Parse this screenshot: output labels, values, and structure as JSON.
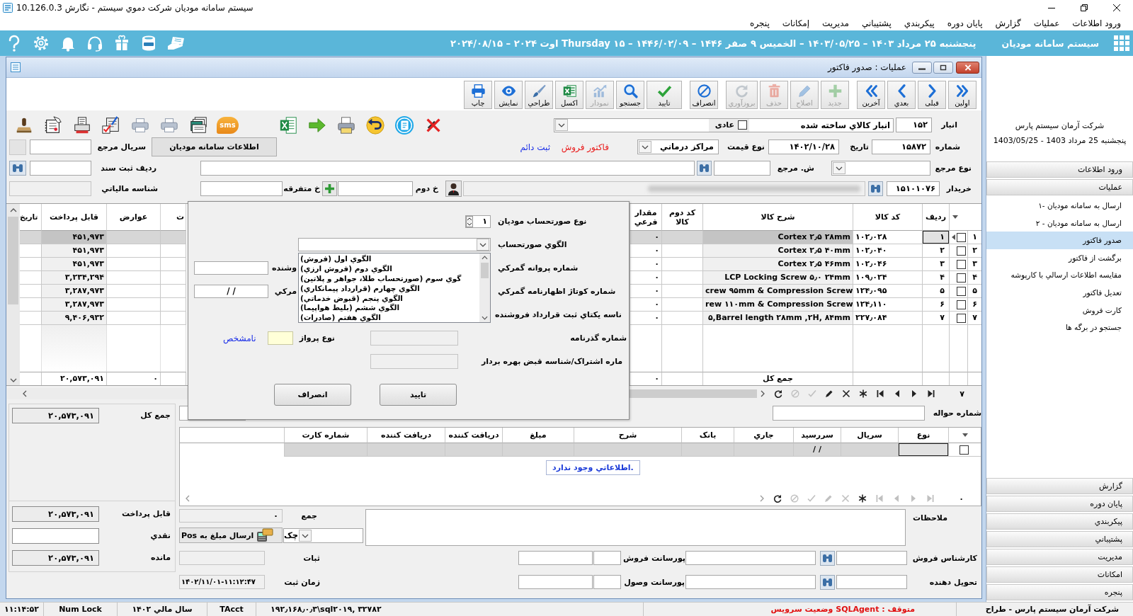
{
  "app": {
    "title": "سیستم سامانه مودیان شرکت دموي سیستم - نگارش 10.126.0.3"
  },
  "menu": [
    {
      "label": "ورود اطلاعات"
    },
    {
      "label": "عملیات"
    },
    {
      "label": "گزارش"
    },
    {
      "label": "پایان دوره"
    },
    {
      "label": "پیکربندي"
    },
    {
      "label": "پشتیباني"
    },
    {
      "label": "مدیریت"
    },
    {
      "label": "إمکانات"
    },
    {
      "label": "پنجره"
    }
  ],
  "header": {
    "app_name": "سیستم سامانه مودیان",
    "date_line": "پنجشنبه ۲۵ مرداد ۱۴۰۳ – ۱۴۰۳/۰۵/۲۵ – الخمیس ۹ صفر ۱۴۴۶ – ۱۴۴۶/۰۲/۰۹ – ۱۵ Thursday اوت ۲۰۲۴ – ۲۰۲۴/۰۸/۱۵"
  },
  "form_window": {
    "title": "عملیات : صدور فاکتور"
  },
  "toolbar": [
    {
      "kind": "first",
      "label": "اولین",
      "disabled": false
    },
    {
      "kind": "prev",
      "label": "قبلی",
      "disabled": false
    },
    {
      "kind": "next",
      "label": "بعدي",
      "disabled": false
    },
    {
      "kind": "last",
      "label": "آخرین",
      "disabled": false
    },
    {
      "kind": "new",
      "label": "جدید",
      "disabled": true
    },
    {
      "kind": "edit",
      "label": "اصلاح",
      "disabled": true
    },
    {
      "kind": "delete",
      "label": "حذف",
      "disabled": true
    },
    {
      "kind": "refresh",
      "label": "بروزآوري",
      "disabled": true
    },
    {
      "kind": "cancel",
      "label": "انصراف",
      "disabled": false
    },
    {
      "kind": "confirm",
      "label": "تایید",
      "disabled": false
    },
    {
      "kind": "search",
      "label": "جستجو",
      "disabled": false
    },
    {
      "kind": "chart",
      "label": "نمودار",
      "disabled": true
    },
    {
      "kind": "excel",
      "label": "اکسل",
      "disabled": false
    },
    {
      "kind": "design",
      "label": "طراحي",
      "disabled": false
    },
    {
      "kind": "view",
      "label": "نمایش",
      "disabled": false
    },
    {
      "kind": "print",
      "label": "چاپ",
      "disabled": false
    }
  ],
  "quick_tools": {
    "sms_label": "sms"
  },
  "invoice": {
    "warehouse": {
      "label": "انبار",
      "code": "۱۵۲",
      "name": "انبار کالاي ساخته شده"
    },
    "regular": {
      "label": "عادی",
      "checked": false
    },
    "number": {
      "label": "شماره",
      "value": "۱۵۸۷۲"
    },
    "date": {
      "label": "تاریخ",
      "value": "۱۴۰۲/۱۰/۲۸"
    },
    "price_type": {
      "label": "نوع قیمت",
      "value": "مراکز درماني"
    },
    "invoice_type": "فاکتور فروش",
    "status": "ثبت دائم",
    "moadian_button": "اطلاعات سامانه مودیان",
    "ref_serial": {
      "label": "سریال مرجع"
    },
    "ref_type": {
      "label": "نوع مرجع"
    },
    "ref_number": {
      "label": "ش. مرجع"
    },
    "doc_row": {
      "label": "ردیف ثبت سند"
    },
    "buyer": {
      "label": "خریدار",
      "code": "۱۵۱۰۱۰۷۶"
    },
    "second_buyer": {
      "label": "خ دوم"
    },
    "misc_buyer": {
      "label": "خ متفرقه"
    },
    "tax_id": {
      "label": "شناسه مالیاتي"
    }
  },
  "items_table": {
    "columns": {
      "row": "ردیف",
      "code": "کد کالا",
      "description": "شرح کالا",
      "second_code": "کد دوم کالا",
      "sub_quantity": "مقدار فرعي",
      "column_6": "ت",
      "tolls": "عوارض",
      "payable": "قابل پرداخت",
      "date": "تاريخ"
    },
    "rows": [
      {
        "index": "۱",
        "checked": false,
        "selected": true,
        "row": "۱",
        "code": "۱۰۲٫۰۲۸",
        "description": "Cortex ۲٫۵ ۲۸mm",
        "sub_quantity": "۰",
        "payable": "۴۵۱,۹۷۳"
      },
      {
        "index": "۲",
        "checked": false,
        "selected": false,
        "row": "۲",
        "code": "۱۰۲٫۰۴۰",
        "description": "Cortex ۲٫۵ ۴۰mm",
        "sub_quantity": "۰",
        "payable": "۴۵۱,۹۷۳"
      },
      {
        "index": "۳",
        "checked": false,
        "selected": false,
        "row": "۳",
        "code": "۱۰۲٫۰۴۶",
        "description": "Cortex ۲٫۵ ۴۶mm",
        "sub_quantity": "۰",
        "payable": "۴۵۱,۹۷۳"
      },
      {
        "index": "۴",
        "checked": false,
        "selected": false,
        "row": "۴",
        "code": "۱۰۹٫۰۲۴",
        "description": "LCP Locking Screw ۵٫۰ ۲۴mm",
        "sub_quantity": "۰",
        "payable": "۳,۲۳۴,۲۹۴"
      },
      {
        "index": "۵",
        "checked": false,
        "selected": false,
        "row": "۵",
        "code": "۱۲۴٫۰۹۵",
        "description": "crew ۹۵mm & Compression Screw",
        "sub_quantity": "۰",
        "payable": "۳,۲۸۷,۹۷۳"
      },
      {
        "index": "۶",
        "checked": false,
        "selected": false,
        "row": "۶",
        "code": "۱۲۴٫۱۱۰",
        "description": "rew ۱۱۰mm & Compression Screw",
        "sub_quantity": "۰",
        "payable": "۳,۲۸۷,۹۷۳"
      },
      {
        "index": "۷",
        "checked": false,
        "selected": false,
        "row": "۷",
        "code": "۲۲۷٫۰۸۴",
        "description": "۵,Barrel length ۲۸mm ,۲H, ۸۴mm",
        "sub_quantity": "۰",
        "payable": "۹,۴۰۶,۹۳۲"
      }
    ],
    "totals": {
      "label": "جمع کل",
      "sub_quantity": "۰",
      "tolls": "۰",
      "payable": "۲۰,۵۷۳,۰۹۱"
    },
    "nav": {
      "count": "۷",
      "buttons": [
        {
          "kind": "refresh",
          "disabled": false
        },
        {
          "kind": "cancel",
          "disabled": true
        },
        {
          "kind": "post",
          "disabled": true
        },
        {
          "kind": "edit",
          "disabled": false
        },
        {
          "kind": "delete",
          "disabled": false
        },
        {
          "kind": "insert",
          "disabled": false
        },
        {
          "kind": "first",
          "disabled": false
        },
        {
          "kind": "prior",
          "disabled": false
        },
        {
          "kind": "next",
          "disabled": false
        },
        {
          "kind": "last",
          "disabled": false
        }
      ]
    }
  },
  "dialog": {
    "invoice_kind": {
      "label": "نوع صورتحساب مودیان",
      "value": "۱"
    },
    "pattern": {
      "label": "الگوي صورتحساب",
      "expanded": true,
      "options": [
        {
          "label": "الگوي اول (فروش)",
          "selected": false
        },
        {
          "label": "الگوي دوم (فروش ارزي)",
          "selected": false
        },
        {
          "label": "گوي سوم (صورتحساب طلا، جواهر و پلاتین)",
          "selected": false
        },
        {
          "label": "الگوي چهارم (قرارداد پیمانکاري)",
          "selected": false
        },
        {
          "label": "الگوي پنجم (قبوض خدماتي)",
          "selected": false
        },
        {
          "label": "الگوي ششم (بلیط هواپیما)",
          "selected": false
        },
        {
          "label": "الگوي هفتم (صادرات)",
          "selected": false
        }
      ]
    },
    "customs_license": {
      "label": "شماره پروانه گمرکي"
    },
    "seller_field": {
      "label": "وشنده"
    },
    "customs_date": {
      "label": "مرکي",
      "value": "/ /"
    },
    "cottage": {
      "label": "شماره کوتاژ اظهارنامه گمرکي"
    },
    "contract": {
      "label": "ناسه یکتاي ثبت قرارداد فروشنده"
    },
    "passport": {
      "label": "شماره گذرنامه"
    },
    "flight": {
      "label": "نوع پرواز",
      "value": "نامشخص"
    },
    "subscription": {
      "label": "ماره اشتراک/شناسه قبض بهره بردار"
    },
    "buttons": [
      {
        "label": "تایید"
      },
      {
        "label": "انصراف"
      }
    ]
  },
  "summary": {
    "total": {
      "label": "جمع کل",
      "value": "۲۰,۵۷۳,۰۹۱"
    },
    "payable": {
      "label": "قابل پرداخت",
      "value": "۲۰,۵۷۳,۰۹۱"
    },
    "cash": {
      "label": "نقدي"
    },
    "remaining": {
      "label": "مانده",
      "value": "۲۰,۵۷۳,۰۹۱"
    }
  },
  "transfer": {
    "label": "شماره حواله"
  },
  "payments_table": {
    "columns": [
      "نوع",
      "سریال",
      "سررسید",
      "جاري",
      "بانک",
      "شرح",
      "مبلغ",
      "دریافت کننده",
      "دریافت کننده",
      "شماره کارت"
    ],
    "rows": [
      {
        "checked": false,
        "selected": true,
        "due": "/ /"
      }
    ],
    "empty_message": "اطلاعاتي وجود ندارد.",
    "nav": {
      "count": "۰",
      "buttons": [
        {
          "kind": "refresh",
          "disabled": false
        },
        {
          "kind": "cancel",
          "disabled": true
        },
        {
          "kind": "post",
          "disabled": true
        },
        {
          "kind": "edit",
          "disabled": true
        },
        {
          "kind": "delete",
          "disabled": true
        },
        {
          "kind": "insert",
          "disabled": false
        },
        {
          "kind": "first",
          "disabled": true
        },
        {
          "kind": "prior",
          "disabled": true
        },
        {
          "kind": "next",
          "disabled": true
        },
        {
          "kind": "last",
          "disabled": true
        }
      ]
    }
  },
  "footer_form": {
    "notes": {
      "label": "ملاحظات"
    },
    "sum": {
      "label": "جمع",
      "value": "۰"
    },
    "payment_method": {
      "value": "چک"
    },
    "pos_button": {
      "label": "ارسال مبلغ به Pos"
    },
    "registrar": {
      "label": "ثبات"
    },
    "registered_at": {
      "label": "زمان ثبت",
      "value": "۱۴۰۲/۱۱/۰۱-۱۱:۱۲:۴۷"
    },
    "sales_expert": {
      "label": "کارشناس فروش"
    },
    "sales_commission": {
      "label": "پورسانت فروش"
    },
    "deliverer": {
      "label": "تحویل دهنده"
    },
    "collection_commission": {
      "label": "پورسانت وصول"
    }
  },
  "sidebar": {
    "company": "شرکت آرمان سیستم پارس",
    "date": "پنجشنبه 25 مرداد 1403 - 1403/05/25",
    "sections": [
      {
        "label": "ورود اطلاعات"
      },
      {
        "label": "عملیات",
        "items": [
          {
            "label": "ارسال به سامانه مودیان -۱",
            "selected": false
          },
          {
            "label": "ارسال به سامانه مودیان - ۲",
            "selected": false
          },
          {
            "label": "صدور فاکتور",
            "selected": true
          },
          {
            "label": "برگشت از فاکتور",
            "selected": false
          },
          {
            "label": "مقایسه اطلاعات ارسالي با کارپوشه",
            "selected": false
          },
          {
            "label": "تعدیل فاکتور",
            "selected": false
          },
          {
            "label": "کارت فروش",
            "selected": false
          },
          {
            "label": "جستجو در برگه ها",
            "selected": false
          }
        ]
      },
      {
        "label": "گزارش"
      },
      {
        "label": "پایان دوره"
      },
      {
        "label": "پیکربندي"
      },
      {
        "label": "پشتیباني"
      },
      {
        "label": "مدیریت"
      },
      {
        "label": "امکانات"
      },
      {
        "label": "پنجره"
      }
    ]
  },
  "status_bar": {
    "time": "۱۱:۱۴:۵۲",
    "num_lock": "Num Lock",
    "fiscal_year": "سال مالي ۱۴۰۲",
    "user": "TAcct",
    "server": "۱۹۲٫۱۶۸٫۰٫۳\\sql۲۰۱۹, ۳۲۷۸۲",
    "service_status": "متوقف : SQLAgent وضعیت سرویس",
    "company": "شرکت آرمان سیستم پارس - طراح"
  }
}
